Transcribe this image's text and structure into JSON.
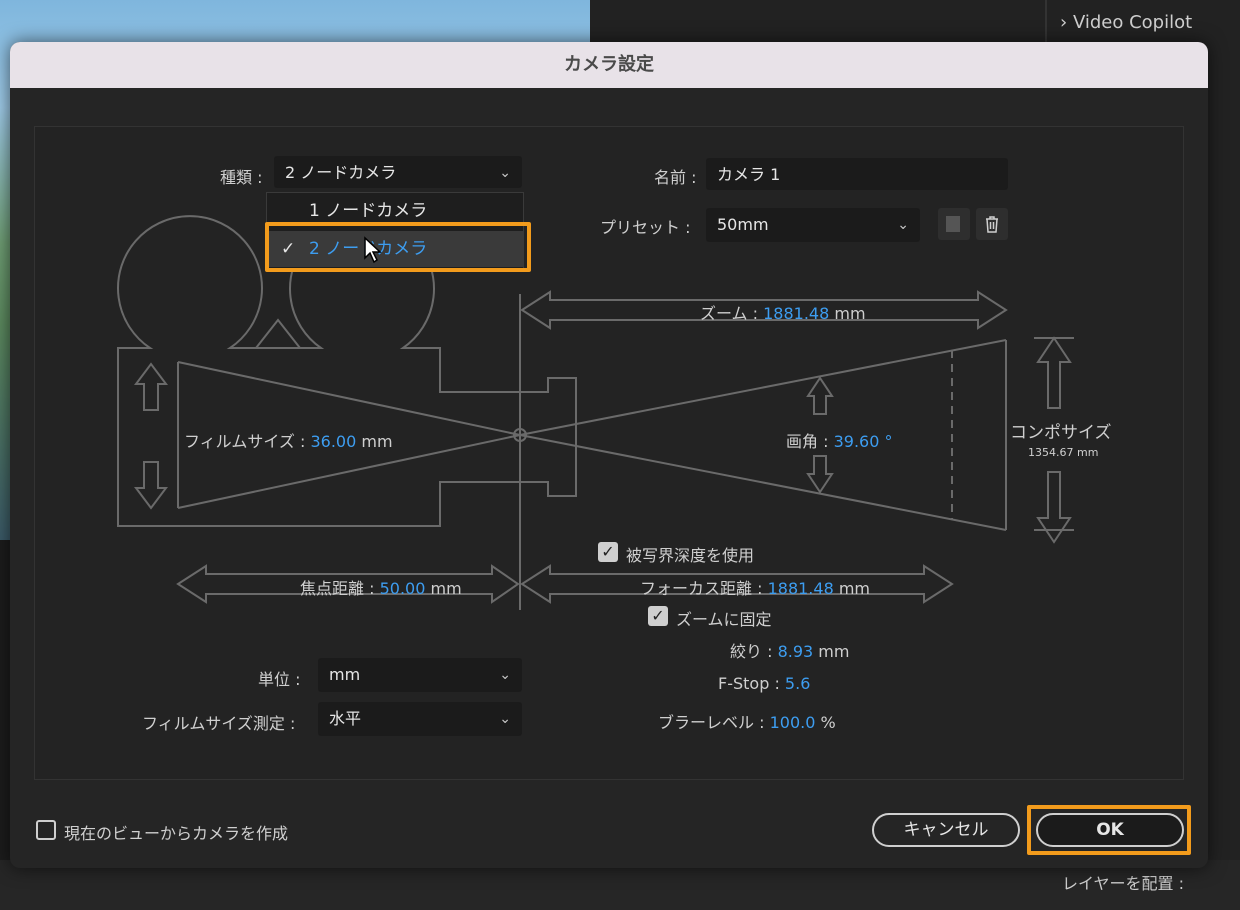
{
  "background": {
    "panel_items": [
      "Video Copilot"
    ],
    "bottom_right_label": "レイヤーを配置 :"
  },
  "dialog": {
    "title": "カメラ設定",
    "type": {
      "label": "種類 :",
      "value": "2 ノードカメラ",
      "options": [
        "1 ノードカメラ",
        "2 ノードカメラ"
      ],
      "selected_index": 1
    },
    "name": {
      "label": "名前 :",
      "value": "カメラ 1"
    },
    "preset": {
      "label": "プリセット :",
      "value": "50mm"
    },
    "diagram": {
      "zoom_label": "ズーム :",
      "zoom_value": "1881.48",
      "zoom_unit": "mm",
      "film_size_label": "フィルムサイズ :",
      "film_size_value": "36.00",
      "film_size_unit": "mm",
      "angle_label": "画角 :",
      "angle_value": "39.60",
      "angle_unit": "°",
      "comp_size_label": "コンポサイズ",
      "comp_size_value": "1354.67 mm",
      "focal_length_label": "焦点距離 :",
      "focal_length_value": "50.00",
      "focal_length_unit": "mm",
      "focus_distance_label": "フォーカス距離 :",
      "focus_distance_value": "1881.48",
      "focus_distance_unit": "mm"
    },
    "dof": {
      "label": "被写界深度を使用",
      "checked": true
    },
    "lock_zoom": {
      "label": "ズームに固定",
      "checked": true
    },
    "aperture": {
      "label": "絞り :",
      "value": "8.93",
      "unit": "mm"
    },
    "fstop": {
      "label": "F-Stop :",
      "value": "5.6"
    },
    "blur": {
      "label": "ブラーレベル :",
      "value": "100.0",
      "unit": "%"
    },
    "units": {
      "label": "単位 :",
      "value": "mm"
    },
    "film_measure": {
      "label": "フィルムサイズ測定 :",
      "value": "水平"
    },
    "create_from_view": {
      "label": "現在のビューからカメラを作成",
      "checked": false
    },
    "cancel_label": "キャンセル",
    "ok_label": "OK",
    "highlight_color": "#f29b1c",
    "value_color": "#3d9df0"
  }
}
